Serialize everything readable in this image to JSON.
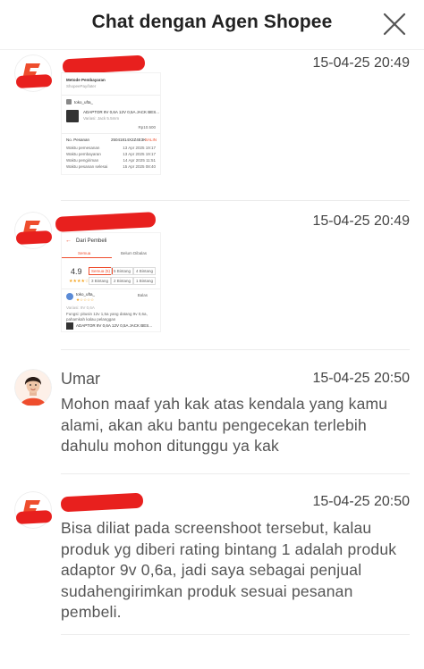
{
  "header": {
    "title": "Chat dengan Agen Shopee",
    "close_icon": "close-icon"
  },
  "messages": [
    {
      "sender": "",
      "timestamp": "15-04-25 20:49",
      "type": "image",
      "screenshot": {
        "title": "Metode Pembayaran",
        "subtitle": "ShopeePay/later",
        "shop": "toko_ufta_",
        "product": "ADAPTOR 9V 0,6A 12V 0,5A JACK BES...",
        "variant": "Variasi: Jack 5.5mm",
        "price": "Rp10.500",
        "order_label": "No. Pesanan",
        "order_no": "25041814X2Z4E3K",
        "copy": "SALIN",
        "rows": [
          {
            "label": "Waktu pemesanan",
            "value": "13 Apr 2025 19:17"
          },
          {
            "label": "Waktu pembayaran",
            "value": "13 Apr 2025 19:17"
          },
          {
            "label": "Waktu pengiriman",
            "value": "14 Apr 2025 11:51"
          },
          {
            "label": "Waktu pesanan selesai",
            "value": "15 Apr 2025 08:40"
          }
        ]
      }
    },
    {
      "sender": "",
      "timestamp": "15-04-25 20:49",
      "type": "image",
      "screenshot": {
        "back_title": "Dari Pembeli",
        "tab1": "Semua",
        "tab2": "Belum Dibalas",
        "rating": "4.9",
        "stars": "★★★★☆",
        "chips": [
          "Semua (5)",
          "5 Bintang",
          "4 Bintang",
          "3 Bintang",
          "2 Bintang",
          "1 Bintang"
        ],
        "reviewer": "toko_ufta_",
        "reviewer_stars": "★☆☆☆☆",
        "reply": "Balas",
        "variant": "Variasi: 9V 0,6A",
        "review_text": "Fungsi: pitusin 12v 1,5a yang datang 9v 0,6a, pahamkah kalau pelanggan",
        "product": "ADAPTOR 9V 0,6A 12V 0,5A JACK BES..."
      }
    },
    {
      "sender": "Umar",
      "timestamp": "15-04-25 20:50",
      "type": "text",
      "text": "Mohon maaf yah kak atas kendala yang kamu alami, akan aku bantu pengecekan terlebih dahulu mohon ditunggu ya kak"
    },
    {
      "sender": "",
      "timestamp": "15-04-25 20:50",
      "type": "text",
      "text": "Bisa diliat pada screenshoot tersebut, kalau produk yg diberi rating bintang 1 adalah produk adaptor 9v 0,6a, jadi saya sebagai penjual sudahengirimkan produk sesuai pesanan pembeli."
    }
  ],
  "colors": {
    "shopee_orange": "#ee4d2d",
    "redaction": "#e8201e",
    "text": "#555555",
    "divider": "#ececec"
  }
}
